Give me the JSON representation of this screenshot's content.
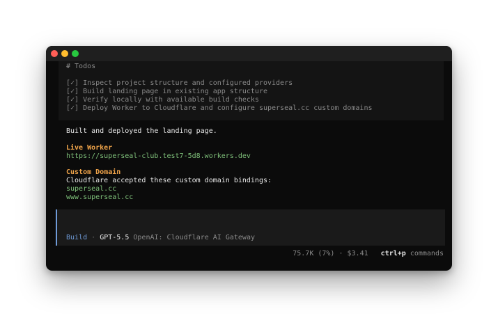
{
  "todos": {
    "heading": "# Todos",
    "items": [
      "[✓] Inspect project structure and configured providers",
      "[✓] Build landing page in existing app structure",
      "[✓] Verify locally with available build checks",
      "[✓] Deploy Worker to Cloudflare and configure superseal.cc custom domains"
    ]
  },
  "message": {
    "summary": "Built and deployed the landing page.",
    "live_worker_label": "Live Worker",
    "live_worker_url": "https://superseal-club.test7-5d8.workers.dev",
    "custom_domain_label": "Custom Domain",
    "custom_domain_text": "Cloudflare accepted these custom domain bindings:",
    "domains": [
      "superseal.cc",
      "www.superseal.cc"
    ]
  },
  "input": {
    "mode": "Build",
    "separator": "·",
    "model": "GPT-5.5",
    "provider": "OpenAI: Cloudflare AI Gateway"
  },
  "status": {
    "usage": "75.7K (7%) · $3.41",
    "shortcut_key": "ctrl+p",
    "shortcut_label": "commands"
  },
  "colors": {
    "accent_orange": "#f0a44a",
    "link_green": "#7fc07a",
    "mode_blue": "#6f9bd8"
  }
}
